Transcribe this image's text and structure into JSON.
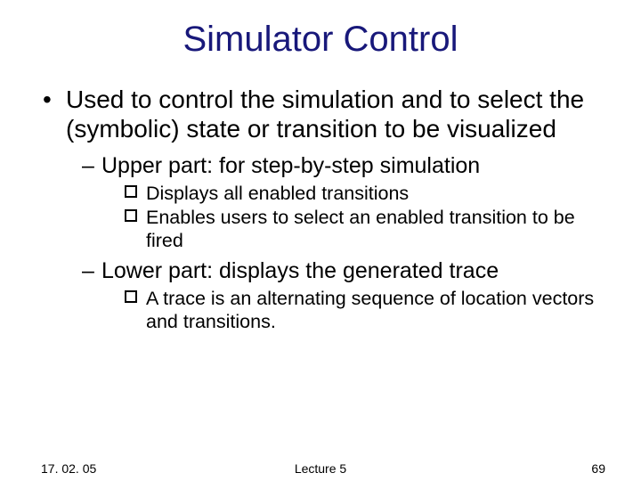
{
  "title": "Simulator Control",
  "bullets": {
    "main": "Used to control the simulation and to select the (symbolic) state or transition to be visualized",
    "upper": {
      "heading": "Upper part: for step-by-step simulation",
      "items": [
        "Displays all enabled transitions",
        "Enables users to select an enabled transition to be fired"
      ]
    },
    "lower": {
      "heading": "Lower part: displays the generated trace",
      "items": [
        "A trace is an alternating sequence of location vectors and transitions."
      ]
    }
  },
  "footer": {
    "date": "17. 02. 05",
    "lecture": "Lecture 5",
    "page": "69"
  }
}
